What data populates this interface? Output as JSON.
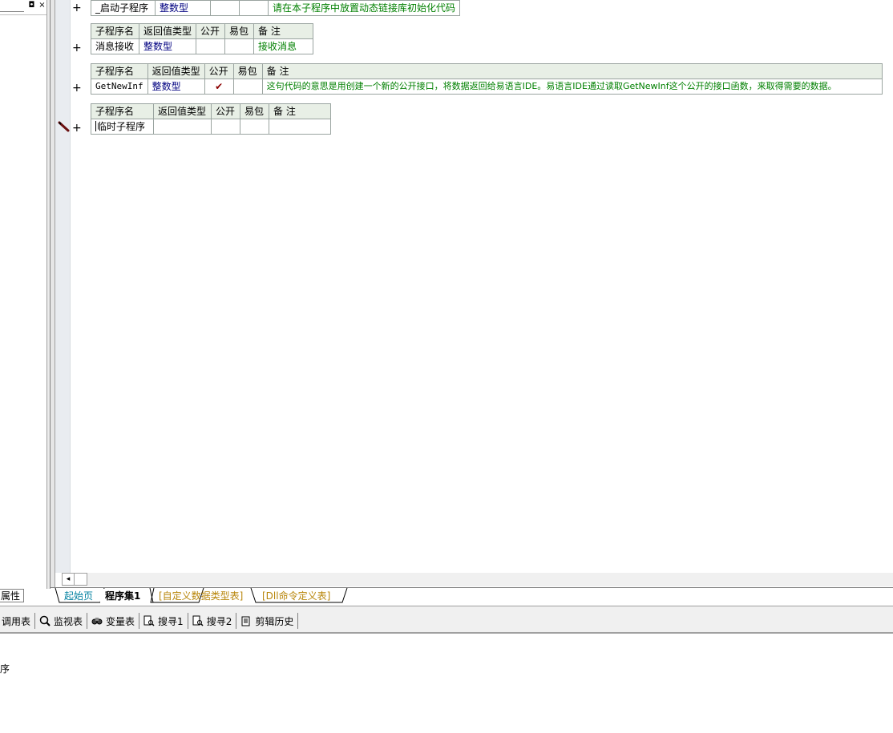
{
  "left_panel": {
    "pin_button": "◘",
    "close_button": "×",
    "properties_tab": "属性"
  },
  "subroutines": [
    {
      "headers": [
        "子程序名",
        "返回值类型",
        "公开",
        "易包",
        "备 注"
      ],
      "name": "_启动子程序",
      "return_type": "整数型",
      "public": "",
      "package": "",
      "note": "请在本子程序中放置动态链接库初始化代码"
    },
    {
      "headers": [
        "子程序名",
        "返回值类型",
        "公开",
        "易包",
        "备 注"
      ],
      "name": "消息接收",
      "return_type": "整数型",
      "public": "",
      "package": "",
      "note": "接收消息"
    },
    {
      "headers": [
        "子程序名",
        "返回值类型",
        "公开",
        "易包",
        "备 注"
      ],
      "name": "GetNewInf",
      "return_type": "整数型",
      "public": "✔",
      "package": "",
      "note": "这句代码的意思是用创建一个新的公开接口，将数据返回给易语言IDE。易语言IDE通过读取GetNewInf这个公开的接口函数，来取得需要的数据。"
    },
    {
      "headers": [
        "子程序名",
        "返回值类型",
        "公开",
        "易包",
        "备 注"
      ],
      "name": "临时子程序",
      "return_type": "",
      "public": "",
      "package": "",
      "note": ""
    }
  ],
  "plus_symbol": "+",
  "scroll_left_arrow": "◂",
  "file_tabs": [
    "起始页",
    "程序集1",
    "[自定义数据类型表]",
    "[Dll命令定义表]"
  ],
  "toolbar": {
    "items": [
      {
        "label": "调用表",
        "icon": "call-table-icon"
      },
      {
        "label": "监视表",
        "icon": "magnifier-icon"
      },
      {
        "label": "变量表",
        "icon": "binoculars-icon"
      },
      {
        "label": "搜寻1",
        "icon": "search-doc-icon"
      },
      {
        "label": "搜寻2",
        "icon": "search-doc-icon"
      },
      {
        "label": "剪辑历史",
        "icon": "clipboard-icon"
      }
    ]
  },
  "output": {
    "text": "序"
  },
  "colors": {
    "header_bg": "#e8efe6",
    "type_color": "#000080",
    "note_color": "#008000",
    "tab_custom_color": "#b8860b"
  }
}
